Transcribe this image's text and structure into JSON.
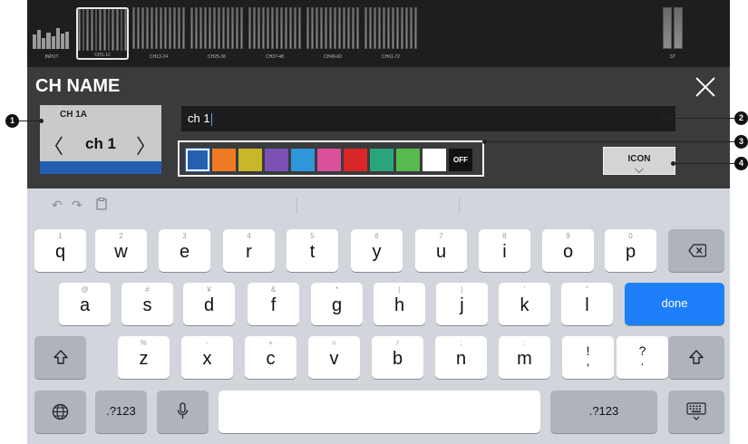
{
  "meter_strip": {
    "groups": [
      "INPUT",
      "CH1-12",
      "CH13-24",
      "CH25-36",
      "CH37-48",
      "CH49-60",
      "CH61-72"
    ],
    "st_label": "ST"
  },
  "panel": {
    "title": "CH NAME",
    "channel_label": "CH 1A",
    "channel_name": "ch 1",
    "name_input_value": "ch 1",
    "selected_color": "#2560b0",
    "colors": [
      "#2560b0",
      "#f07a23",
      "#c9b62a",
      "#7c51b5",
      "#2f96d9",
      "#d9519a",
      "#d9262b",
      "#2aa57b",
      "#58b94e",
      "#ffffff"
    ],
    "off_label": "OFF",
    "icon_button_label": "ICON"
  },
  "callouts": [
    "1",
    "2",
    "3",
    "4"
  ],
  "keyboard": {
    "row1": [
      {
        "main": "q",
        "sub": "1"
      },
      {
        "main": "w",
        "sub": "2"
      },
      {
        "main": "e",
        "sub": "3"
      },
      {
        "main": "r",
        "sub": "4"
      },
      {
        "main": "t",
        "sub": "5"
      },
      {
        "main": "y",
        "sub": "6"
      },
      {
        "main": "u",
        "sub": "7"
      },
      {
        "main": "i",
        "sub": "8"
      },
      {
        "main": "o",
        "sub": "9"
      },
      {
        "main": "p",
        "sub": "0"
      }
    ],
    "row2": [
      {
        "main": "a",
        "sub": "@"
      },
      {
        "main": "s",
        "sub": "#"
      },
      {
        "main": "d",
        "sub": "¥"
      },
      {
        "main": "f",
        "sub": "&"
      },
      {
        "main": "g",
        "sub": "*"
      },
      {
        "main": "h",
        "sub": "("
      },
      {
        "main": "j",
        "sub": ")"
      },
      {
        "main": "k",
        "sub": "'"
      },
      {
        "main": "l",
        "sub": "\""
      }
    ],
    "row3": [
      {
        "main": "z",
        "sub": "%"
      },
      {
        "main": "x",
        "sub": "-"
      },
      {
        "main": "c",
        "sub": "+"
      },
      {
        "main": "v",
        "sub": "="
      },
      {
        "main": "b",
        "sub": "/"
      },
      {
        "main": "n",
        "sub": ";"
      },
      {
        "main": "m",
        "sub": ":"
      },
      {
        "main": "!\n,",
        "sub": ""
      },
      {
        "main": "?\n.",
        "sub": ""
      }
    ],
    "done_label": "done",
    "numbers_label": ".?123",
    "backspace_icon": "backspace-icon",
    "shift_icon": "shift-icon",
    "globe_icon": "globe-icon",
    "mic_icon": "microphone-icon",
    "hide_keyboard_icon": "hide-keyboard-icon",
    "toolbar_icons": [
      "undo-icon",
      "redo-icon",
      "paste-icon"
    ]
  }
}
